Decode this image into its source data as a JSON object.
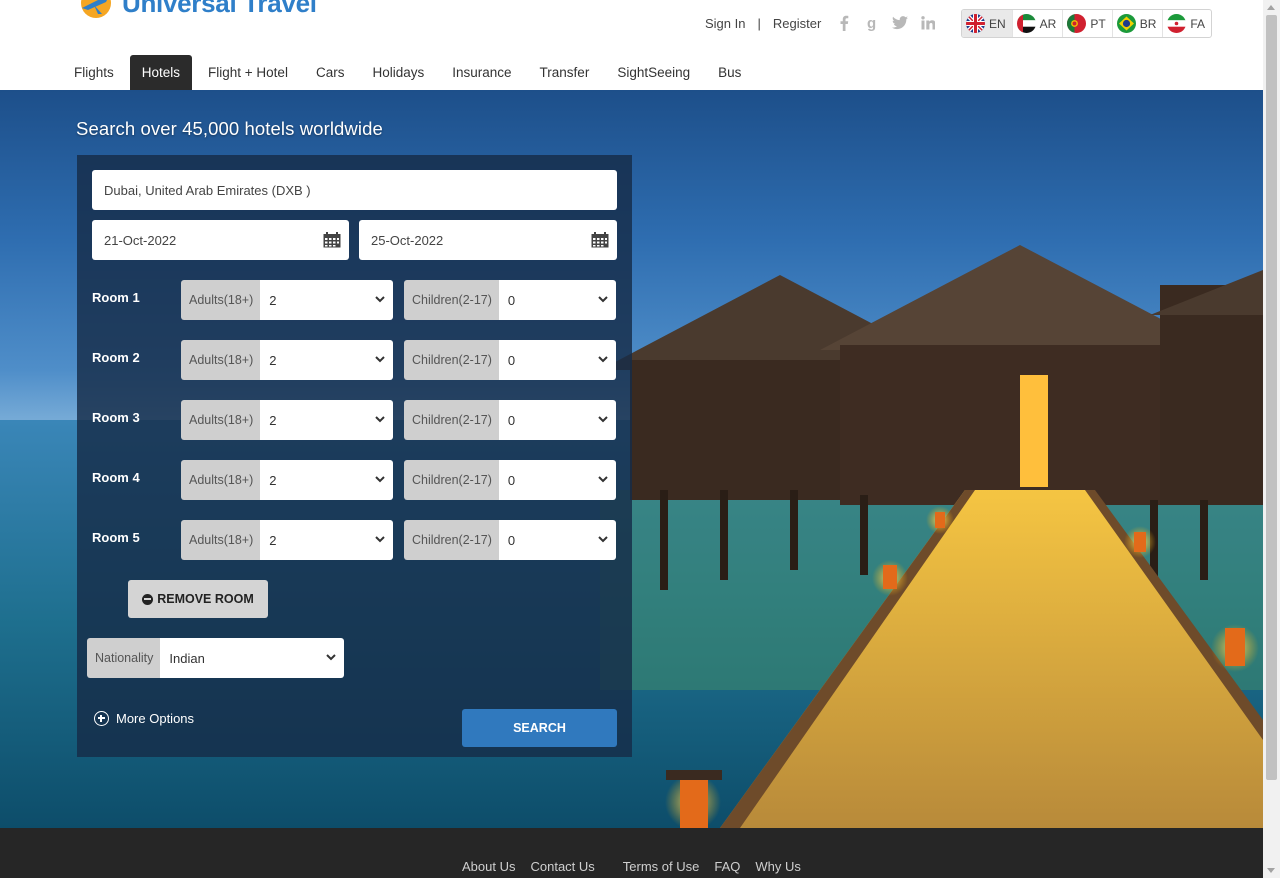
{
  "brand": {
    "name": "Universal Travel",
    "accent": "#2f7fc9"
  },
  "auth": {
    "sign_in": "Sign In",
    "separator": "|",
    "register": "Register"
  },
  "social": [
    "facebook-icon",
    "google-plus-icon",
    "twitter-icon",
    "linkedin-icon"
  ],
  "languages": [
    {
      "code": "EN",
      "flag": "uk-flag-icon",
      "active": true
    },
    {
      "code": "AR",
      "flag": "uae-flag-icon",
      "active": false
    },
    {
      "code": "PT",
      "flag": "portugal-flag-icon",
      "active": false
    },
    {
      "code": "BR",
      "flag": "brazil-flag-icon",
      "active": false
    },
    {
      "code": "FA",
      "flag": "iran-flag-icon",
      "active": false
    }
  ],
  "nav": {
    "tabs": [
      {
        "label": "Flights"
      },
      {
        "label": "Hotels",
        "active": true
      },
      {
        "label": "Flight + Hotel"
      },
      {
        "label": "Cars"
      },
      {
        "label": "Holidays"
      },
      {
        "label": "Insurance"
      },
      {
        "label": "Transfer"
      },
      {
        "label": "SightSeeing"
      },
      {
        "label": "Bus"
      }
    ]
  },
  "search": {
    "title": "Search over 45,000 hotels worldwide",
    "destination": "Dubai, United Arab Emirates (DXB )",
    "checkin": "21-Oct-2022",
    "checkout": "25-Oct-2022",
    "adults_label": "Adults(18+)",
    "children_label": "Children(2-17)",
    "rooms": [
      {
        "label": "Room 1",
        "adults": "2",
        "children": "0"
      },
      {
        "label": "Room 2",
        "adults": "2",
        "children": "0"
      },
      {
        "label": "Room 3",
        "adults": "2",
        "children": "0"
      },
      {
        "label": "Room 4",
        "adults": "2",
        "children": "0"
      },
      {
        "label": "Room 5",
        "adults": "2",
        "children": "0"
      }
    ],
    "remove_room": "REMOVE ROOM",
    "nationality_label": "Nationality",
    "nationality": "Indian",
    "more_options": "More Options",
    "search_button": "SEARCH",
    "button_color": "#3079be"
  },
  "footer": {
    "links": [
      "About Us",
      "Contact Us",
      "Terms of Use",
      "FAQ",
      "Why Us"
    ]
  }
}
